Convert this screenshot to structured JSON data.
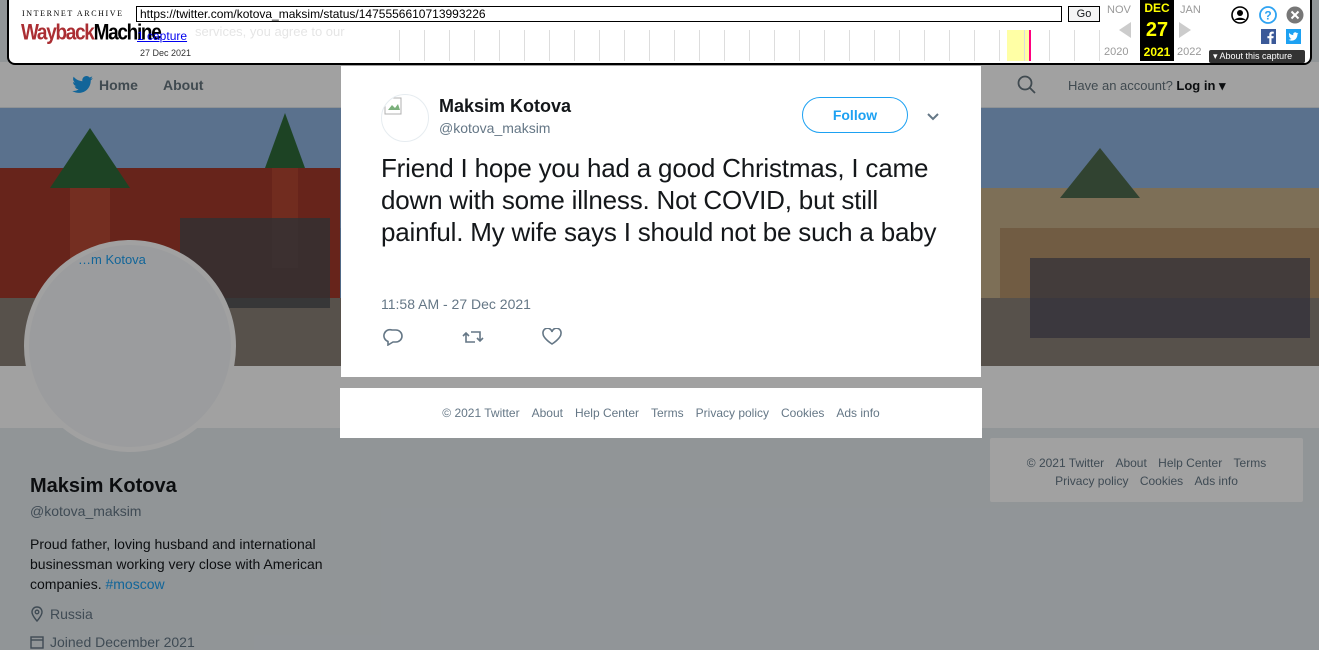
{
  "wayback": {
    "ia_label": "INTERNET ARCHIVE",
    "logo_part1": "Wayback",
    "logo_part2": "Machine",
    "url": "https://twitter.com/kotova_maksim/status/1475556610713993226",
    "go_label": "Go",
    "captures_label": "1 capture",
    "captures_date": "27 Dec 2021",
    "behind_text": "services, you agree to our",
    "prev_month": "NOV",
    "prev_year": "2020",
    "cur_month": "DEC",
    "cur_day": "27",
    "cur_year": "2021",
    "next_month": "JAN",
    "next_year": "2022",
    "about_capture": "About this capture",
    "accent": "#ab2e33"
  },
  "nav": {
    "home": "Home",
    "about": "About",
    "have_account": "Have an account?",
    "login": "Log in"
  },
  "profile": {
    "avatar_alt": "…m Kotova",
    "name": "Maksim Kotova",
    "handle": "@kotova_maksim",
    "bio": "Proud father, loving husband and international businessman working very close with American companies. ",
    "bio_tag": "#moscow",
    "location": "Russia",
    "joined": "Joined December 2021"
  },
  "tweet": {
    "author_name": "Maksim Kotova",
    "author_handle": "@kotova_maksim",
    "follow_label": "Follow",
    "text": "Friend I hope you had a good Christmas, I came down with some illness. Not COVID, but still painful. My wife says I should not be such a baby",
    "timestamp": "11:58 AM - 27 Dec 2021"
  },
  "modal_footer": [
    "© 2021 Twitter",
    "About",
    "Help Center",
    "Terms",
    "Privacy policy",
    "Cookies",
    "Ads info"
  ],
  "side_footer": {
    "line1": [
      "© 2021 Twitter",
      "About",
      "Help Center",
      "Terms"
    ],
    "line2": [
      "Privacy policy",
      "Cookies",
      "Ads info"
    ]
  },
  "colors": {
    "twitter_blue": "#1da1f2",
    "text_dark": "#14171a",
    "text_gray": "#657786"
  }
}
